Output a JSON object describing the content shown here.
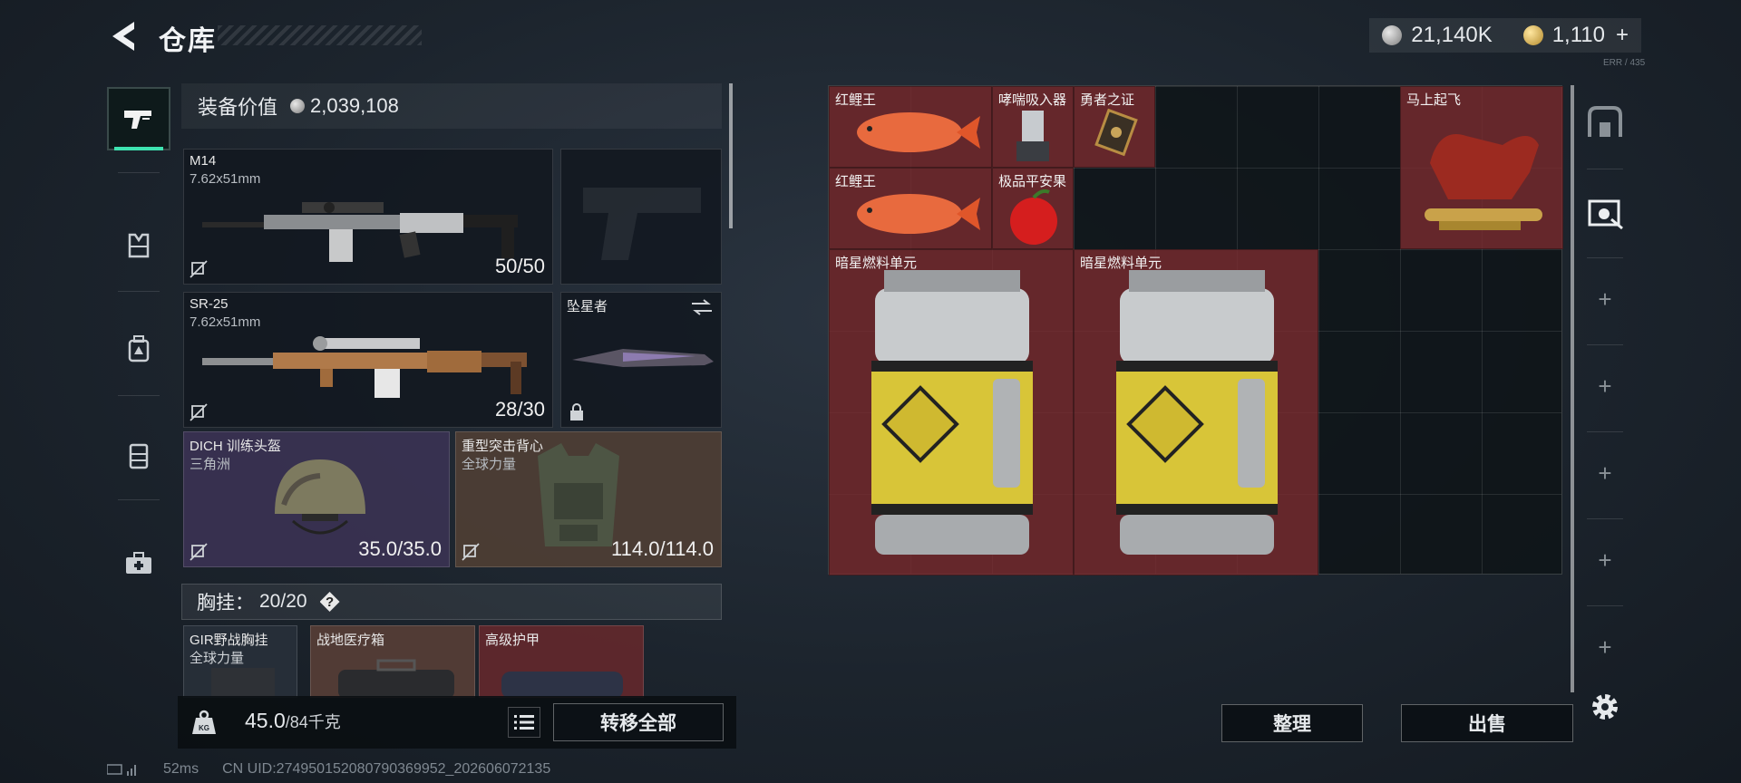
{
  "header": {
    "title": "仓库",
    "currency_silver": "21,140K",
    "currency_gold": "1,110",
    "currency_add": "+",
    "corner_info": "ERR / 435"
  },
  "equipment": {
    "value_label": "装备价值",
    "value": "2,039,108",
    "primary_weapon": {
      "name": "M14",
      "caliber": "7.62x51mm",
      "ammo": "50/50"
    },
    "secondary_weapon": {
      "name": "SR-25",
      "caliber": "7.62x51mm",
      "ammo": "28/30"
    },
    "melee": {
      "name": "坠星者"
    },
    "helmet": {
      "name": "DICH 训练头盔",
      "sub": "三角洲",
      "durability": "35.0/35.0"
    },
    "armor": {
      "name": "重型突击背心",
      "sub": "全球力量",
      "durability": "114.0/114.0"
    },
    "rig": {
      "label": "胸挂：",
      "capacity": "20/20",
      "help": "?"
    },
    "row_items": [
      {
        "name": "GIR野战胸挂",
        "sub": "全球力量"
      },
      {
        "name": "战地医疗箱"
      },
      {
        "name": "高级护甲"
      }
    ]
  },
  "bottom_left": {
    "weight": "45.0",
    "weight_max": "/84千克",
    "weight_icon_label": "KG",
    "transfer_all": "转移全部"
  },
  "status": {
    "ping": "52ms",
    "uid": "CN UID:274950152080790369952_202606072135"
  },
  "stash": {
    "items": [
      {
        "name": "红鲤王"
      },
      {
        "name": "哮喘吸入器"
      },
      {
        "name": "勇者之证"
      },
      {
        "name": "马上起飞"
      },
      {
        "name": "红鲤王"
      },
      {
        "name": "极品平安果"
      },
      {
        "name": "暗星燃料单元"
      },
      {
        "name": "暗星燃料单元"
      }
    ]
  },
  "actions": {
    "sort": "整理",
    "sell": "出售"
  },
  "icons": {
    "back": "back-arrow-icon",
    "nav": [
      "weapon-icon",
      "armor-icon",
      "backpack-icon",
      "rig-icon",
      "medkit-icon"
    ],
    "right_nav": [
      "safe-box-icon",
      "ticket-icon"
    ]
  },
  "colors": {
    "accent": "#3ee3b0",
    "item_red": "#7a2c30",
    "slot_purple": "#3a3252",
    "slot_brown": "#4e3e34"
  }
}
